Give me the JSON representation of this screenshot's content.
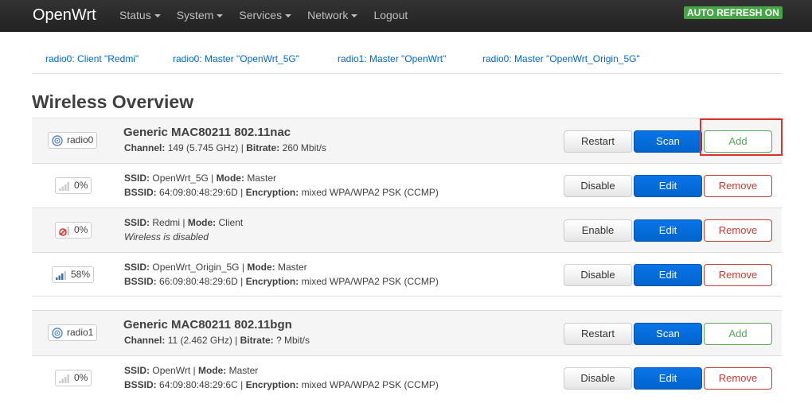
{
  "brand": "OpenWrt",
  "menu": [
    "Status",
    "System",
    "Services",
    "Network",
    "Logout"
  ],
  "auto_refresh": "AUTO REFRESH ON",
  "tabs": [
    "radio0: Client \"Redmi\"",
    "radio0: Master \"OpenWrt_5G\"",
    "radio1: Master \"OpenWrt\"",
    "radio0: Master \"OpenWrt_Origin_5G\""
  ],
  "title": "Wireless Overview",
  "labels": {
    "channel": "Channel:",
    "bitrate": "Bitrate:",
    "ssid": "SSID:",
    "mode": "Mode:",
    "bssid": "BSSID:",
    "encryption": "Encryption:"
  },
  "buttons": {
    "restart": "Restart",
    "scan": "Scan",
    "add": "Add",
    "disable": "Disable",
    "enable": "Enable",
    "edit": "Edit",
    "remove": "Remove"
  },
  "devices": [
    {
      "radio": "radio0",
      "name": "Generic MAC80211 802.11nac",
      "channel": "149 (5.745 GHz)",
      "bitrate": "260 Mbit/s",
      "networks": [
        {
          "signal": "0%",
          "signal_icon": "signal-0-icon",
          "ssid": "OpenWrt_5G",
          "mode": "Master",
          "bssid": "64:09:80:48:29:6D",
          "encryption": "mixed WPA/WPA2 PSK (CCMP)",
          "toggle": "Disable"
        },
        {
          "signal": "0%",
          "signal_icon": "signal-disabled-icon",
          "ssid": "Redmi",
          "mode": "Client",
          "status": "Wireless is disabled",
          "toggle": "Enable"
        },
        {
          "signal": "58%",
          "signal_icon": "signal-58-icon",
          "ssid": "OpenWrt_Origin_5G",
          "mode": "Master",
          "bssid": "66:09:80:48:29:6D",
          "encryption": "mixed WPA/WPA2 PSK (CCMP)",
          "toggle": "Disable"
        }
      ]
    },
    {
      "radio": "radio1",
      "name": "Generic MAC80211 802.11bgn",
      "channel": "11 (2.462 GHz)",
      "bitrate": "? Mbit/s",
      "networks": [
        {
          "signal": "0%",
          "signal_icon": "signal-0-icon",
          "ssid": "OpenWrt",
          "mode": "Master",
          "bssid": "64:09:80:48:29:6C",
          "encryption": "mixed WPA/WPA2 PSK (CCMP)",
          "toggle": "Disable"
        }
      ]
    }
  ]
}
